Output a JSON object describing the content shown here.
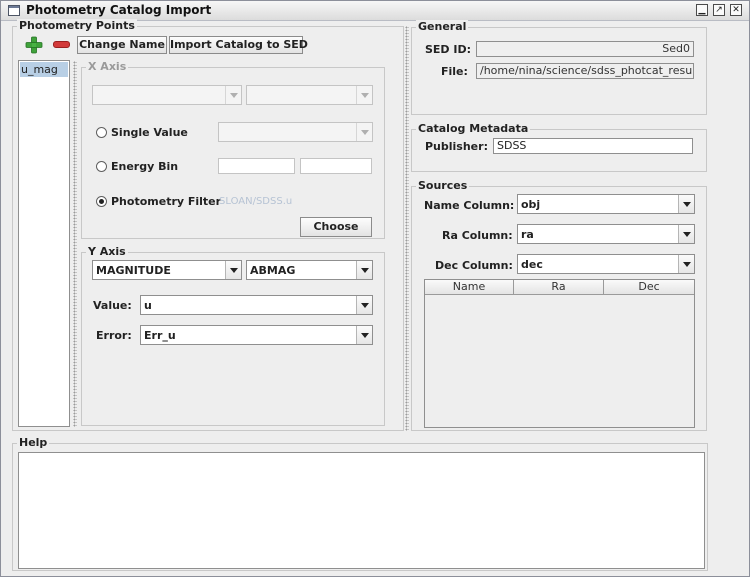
{
  "window": {
    "title": "Photometry Catalog Import"
  },
  "photometry_points": {
    "title": "Photometry Points",
    "change_name_label": "Change Name",
    "import_label": "Import Catalog to SED",
    "items": [
      "u_mag"
    ]
  },
  "x_axis": {
    "title": "X Axis",
    "single_value_label": "Single Value",
    "energy_bin_label": "Energy Bin",
    "photometry_filter_label": "Photometry Filter",
    "filter_value": "SLOAN/SDSS.u",
    "choose_label": "Choose"
  },
  "y_axis": {
    "title": "Y Axis",
    "quantity": "MAGNITUDE",
    "unit": "ABMAG",
    "value_label": "Value:",
    "value": "u",
    "error_label": "Error:",
    "error": "Err_u"
  },
  "general": {
    "title": "General",
    "sed_id_label": "SED ID:",
    "sed_id": "Sed0",
    "file_label": "File:",
    "file": "/home/nina/science/sdss_photcat_results"
  },
  "catalog_metadata": {
    "title": "Catalog Metadata",
    "publisher_label": "Publisher:",
    "publisher": "SDSS"
  },
  "sources": {
    "title": "Sources",
    "name_column_label": "Name Column:",
    "name_column": "obj",
    "ra_column_label": "Ra Column:",
    "ra_column": "ra",
    "dec_column_label": "Dec Column:",
    "dec_column": "dec",
    "table_headers": [
      "Name",
      "Ra",
      "Dec"
    ]
  },
  "help": {
    "title": "Help"
  },
  "colors": {
    "accent_selection": "#b8cfe5",
    "add_icon": "#3fa23a",
    "remove_icon": "#d23a3a"
  }
}
